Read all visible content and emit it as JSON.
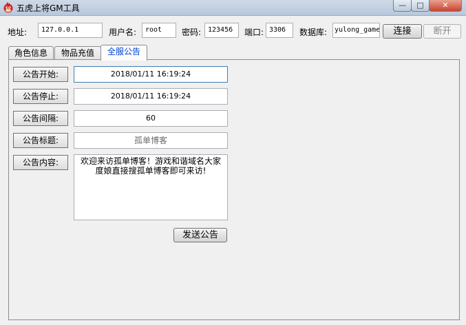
{
  "window": {
    "title": "五虎上将GM工具",
    "min_glyph": "—",
    "max_glyph": "□",
    "close_glyph": "✕"
  },
  "connection": {
    "address_label": "地址:",
    "address_value": "127.0.0.1",
    "user_label": "用户名:",
    "user_value": "root",
    "password_label": "密码:",
    "password_value": "123456",
    "port_label": "端口:",
    "port_value": "3306",
    "db_label": "数据库:",
    "db_value": "yulong_game",
    "connect_label": "连接",
    "disconnect_label": "断开"
  },
  "tabs": [
    "角色信息",
    "物品充值",
    "全服公告"
  ],
  "active_tab": "全服公告",
  "announcement": {
    "start_label": "公告开始:",
    "start_value": "2018/01/11 16:19:24",
    "stop_label": "公告停止:",
    "stop_value": "2018/01/11 16:19:24",
    "interval_label": "公告间隔:",
    "interval_value": "60",
    "title_label": "公告标题:",
    "title_value": "孤单博客",
    "content_label": "公告内容:",
    "content_value": "欢迎来访孤单博客！游戏和谐域名大家度娘直接搜孤单博客即可来访!",
    "send_label": "发送公告"
  }
}
